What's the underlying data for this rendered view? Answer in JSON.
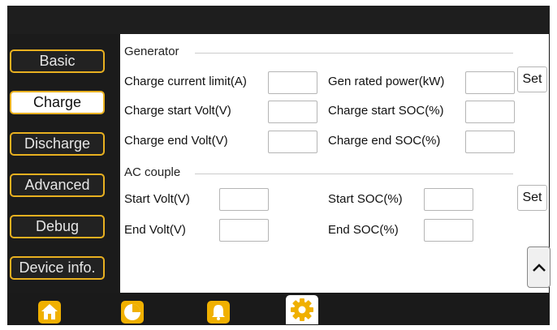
{
  "sidebar": {
    "items": [
      {
        "label": "Basic"
      },
      {
        "label": "Charge"
      },
      {
        "label": "Discharge"
      },
      {
        "label": "Advanced"
      },
      {
        "label": "Debug"
      },
      {
        "label": "Device info."
      }
    ],
    "active": "Charge"
  },
  "generator": {
    "title": "Generator",
    "charge_current_limit_label": "Charge current limit(A)",
    "gen_rated_power_label": "Gen rated power(kW)",
    "charge_start_volt_label": "Charge start Volt(V)",
    "charge_start_soc_label": "Charge start SOC(%)",
    "charge_end_volt_label": "Charge end Volt(V)",
    "charge_end_soc_label": "Charge end SOC(%)",
    "set_label": "Set"
  },
  "ac_couple": {
    "title": "AC couple",
    "start_volt_label": "Start Volt(V)",
    "start_soc_label": "Start SOC(%)",
    "end_volt_label": "End Volt(V)",
    "end_soc_label": "End SOC(%)",
    "set_label": "Set"
  },
  "tabs": [
    {
      "icon": "home-icon"
    },
    {
      "icon": "pie-chart-icon"
    },
    {
      "icon": "bell-icon"
    },
    {
      "icon": "gear-icon"
    }
  ],
  "colors": {
    "accent": "#e8b020",
    "dark": "#151515"
  }
}
